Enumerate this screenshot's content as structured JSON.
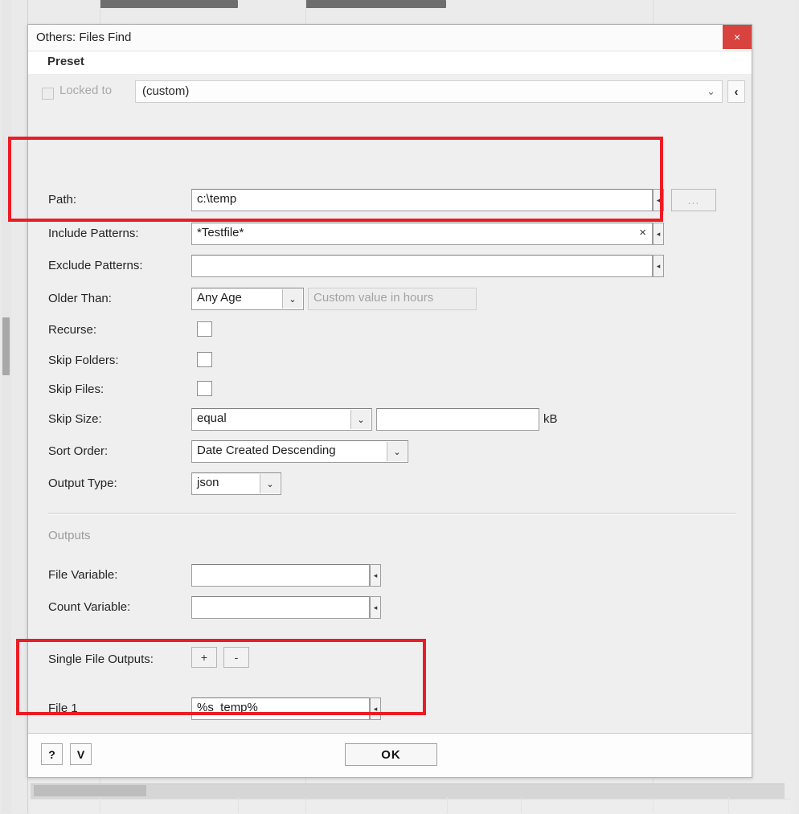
{
  "background": {
    "bars": [
      "toolbar-bar-1",
      "toolbar-bar-2"
    ]
  },
  "dialog": {
    "title": "Others: Files Find",
    "close_label": "×",
    "preset_section_label": "Preset",
    "locked_to_label": "Locked to",
    "preset_value": "(custom)",
    "preset_chevron": "⌄",
    "preset_back_label": "‹"
  },
  "fields": {
    "path": {
      "label": "Path:",
      "value": "c:\\temp",
      "browse_label": "..."
    },
    "include_patterns": {
      "label": "Include Patterns:",
      "value": "*Testfile*",
      "clear_label": "×"
    },
    "exclude_patterns": {
      "label": "Exclude Patterns:",
      "value": ""
    },
    "older_than": {
      "label": "Older Than:",
      "value": "Any Age",
      "custom_placeholder": "Custom value in hours",
      "custom_value": ""
    },
    "recurse": {
      "label": "Recurse:",
      "checked": false
    },
    "skip_folders": {
      "label": "Skip Folders:",
      "checked": false
    },
    "skip_files": {
      "label": "Skip Files:",
      "checked": false
    },
    "skip_size": {
      "label": "Skip Size:",
      "comparator": "equal",
      "value": "",
      "unit": "kB"
    },
    "sort_order": {
      "label": "Sort Order:",
      "value": "Date Created Descending"
    },
    "output_type": {
      "label": "Output Type:",
      "value": "json"
    }
  },
  "outputs": {
    "section_label": "Outputs",
    "file_variable": {
      "label": "File Variable:",
      "value": ""
    },
    "count_variable": {
      "label": "Count Variable:",
      "value": ""
    },
    "single_file_outputs": {
      "label": "Single File Outputs:",
      "add_label": "+",
      "remove_label": "-"
    },
    "file_1": {
      "label": "File 1",
      "value": "%s_temp%"
    }
  },
  "footer": {
    "help_label": "?",
    "version_label": "V",
    "ok_label": "OK"
  },
  "colors": {
    "annotation": "#ec1c24",
    "close_button": "#d9433f",
    "dialog_bg": "#efefef"
  },
  "icons": {
    "expander": "◂",
    "combo_arrow": "⌄"
  }
}
